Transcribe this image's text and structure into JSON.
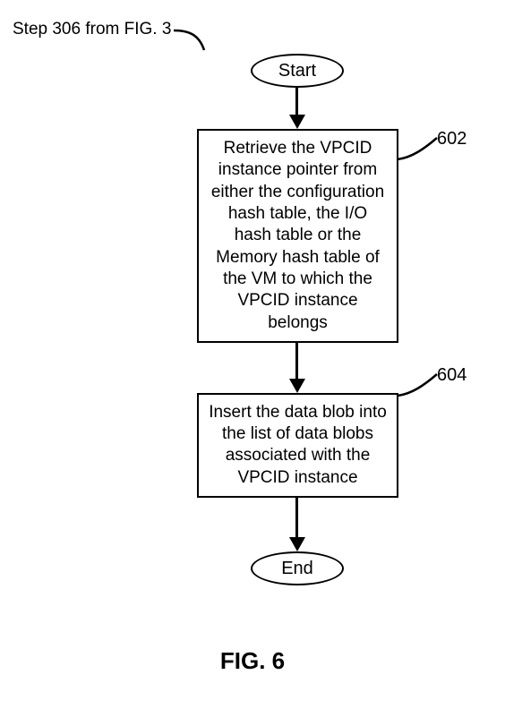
{
  "caption_top": "Step 306 from FIG. 3",
  "start": "Start",
  "end": "End",
  "step_602": {
    "ref": "602",
    "text": "Retrieve the VPCID instance pointer from either the configuration hash table, the I/O hash table or the Memory hash table of the VM to which the VPCID instance belongs"
  },
  "step_604": {
    "ref": "604",
    "text": "Insert the data blob into the list of data blobs associated with the VPCID instance"
  },
  "figure_label": "FIG. 6",
  "chart_data": {
    "type": "flowchart",
    "nodes": [
      {
        "id": "start",
        "kind": "terminator",
        "label": "Start"
      },
      {
        "id": "602",
        "kind": "process",
        "label": "Retrieve the VPCID instance pointer from either the configuration hash table, the I/O hash table or the Memory hash table of the VM to which the VPCID instance belongs"
      },
      {
        "id": "604",
        "kind": "process",
        "label": "Insert the data blob into the list of data blobs associated with the VPCID instance"
      },
      {
        "id": "end",
        "kind": "terminator",
        "label": "End"
      }
    ],
    "edges": [
      {
        "from": "start",
        "to": "602"
      },
      {
        "from": "602",
        "to": "604"
      },
      {
        "from": "604",
        "to": "end"
      }
    ],
    "entry_reference": "Step 306 from FIG. 3",
    "figure": "FIG. 6"
  }
}
